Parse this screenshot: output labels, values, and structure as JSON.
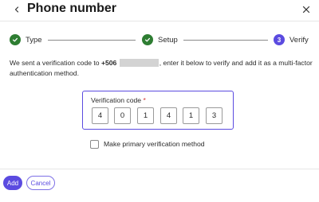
{
  "header": {
    "title": "Phone number"
  },
  "stepper": {
    "steps": [
      {
        "label": "Type",
        "status": "done"
      },
      {
        "label": "Setup",
        "status": "done"
      },
      {
        "label": "Verify",
        "status": "current",
        "number": "3"
      }
    ]
  },
  "description": {
    "prefix": "We sent a verification code to ",
    "phone_prefix": "+506",
    "suffix": ", enter it below to verify and add it as a multi-factor authentication method."
  },
  "verification": {
    "label": "Verification code",
    "required_mark": "*",
    "digits": [
      "4",
      "0",
      "1",
      "4",
      "1",
      "3"
    ]
  },
  "checkbox": {
    "label": "Make primary verification method",
    "checked": false
  },
  "buttons": {
    "add_label": "Add",
    "cancel_label": "Cancel"
  },
  "colors": {
    "accent": "#5b4be0",
    "success": "#2e7d32",
    "required": "#d32f2f"
  },
  "icons": {
    "back": "chevron-left-icon",
    "close": "close-icon",
    "done": "check-icon"
  }
}
